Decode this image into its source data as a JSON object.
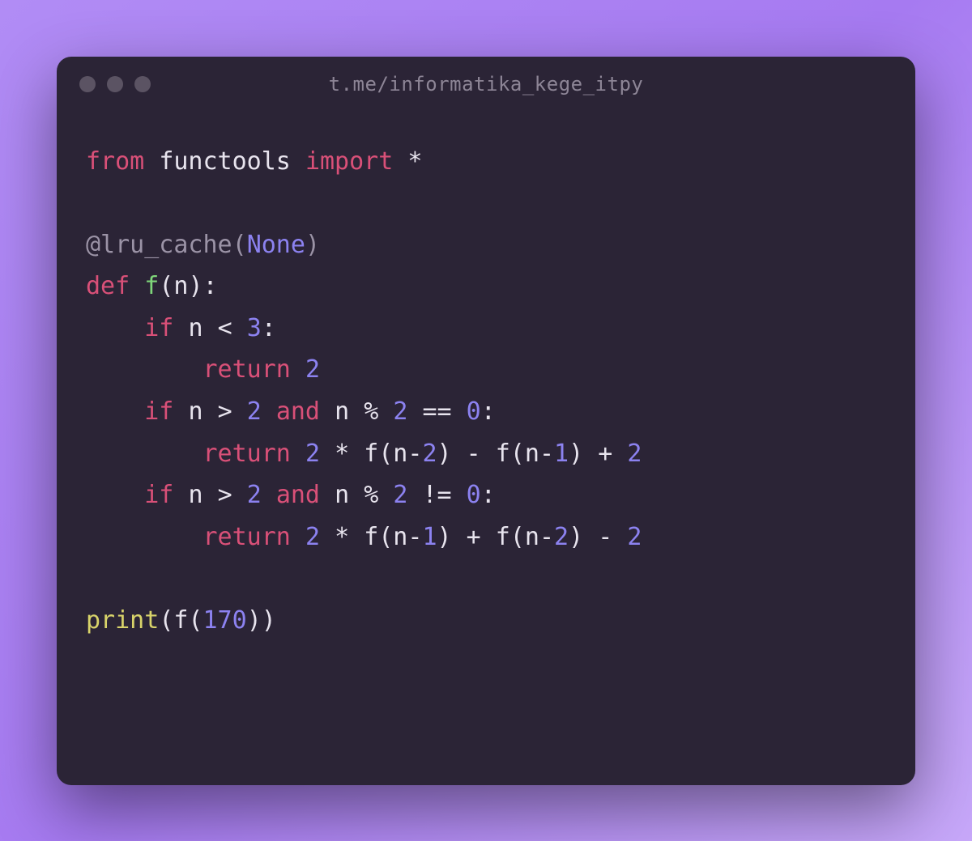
{
  "window": {
    "title": "t.me/informatika_kege_itpy"
  },
  "code": {
    "lines": [
      [
        {
          "text": "from",
          "cls": "kw"
        },
        {
          "text": " ",
          "cls": ""
        },
        {
          "text": "functools",
          "cls": "mod"
        },
        {
          "text": " ",
          "cls": ""
        },
        {
          "text": "import",
          "cls": "kw"
        },
        {
          "text": " ",
          "cls": ""
        },
        {
          "text": "*",
          "cls": "star"
        }
      ],
      [],
      [
        {
          "text": "@lru_cache",
          "cls": "dec"
        },
        {
          "text": "(",
          "cls": "dec"
        },
        {
          "text": "None",
          "cls": "none"
        },
        {
          "text": ")",
          "cls": "dec"
        }
      ],
      [
        {
          "text": "def",
          "cls": "kw"
        },
        {
          "text": " ",
          "cls": ""
        },
        {
          "text": "f",
          "cls": "fn"
        },
        {
          "text": "(",
          "cls": "punc"
        },
        {
          "text": "n",
          "cls": "var"
        },
        {
          "text": ")",
          "cls": "punc"
        },
        {
          "text": ":",
          "cls": "punc"
        }
      ],
      [
        {
          "text": "    ",
          "cls": ""
        },
        {
          "text": "if",
          "cls": "kw"
        },
        {
          "text": " ",
          "cls": ""
        },
        {
          "text": "n",
          "cls": "var"
        },
        {
          "text": " ",
          "cls": ""
        },
        {
          "text": "<",
          "cls": "op"
        },
        {
          "text": " ",
          "cls": ""
        },
        {
          "text": "3",
          "cls": "num"
        },
        {
          "text": ":",
          "cls": "punc"
        }
      ],
      [
        {
          "text": "        ",
          "cls": ""
        },
        {
          "text": "return",
          "cls": "kw"
        },
        {
          "text": " ",
          "cls": ""
        },
        {
          "text": "2",
          "cls": "num"
        }
      ],
      [
        {
          "text": "    ",
          "cls": ""
        },
        {
          "text": "if",
          "cls": "kw"
        },
        {
          "text": " ",
          "cls": ""
        },
        {
          "text": "n",
          "cls": "var"
        },
        {
          "text": " ",
          "cls": ""
        },
        {
          "text": ">",
          "cls": "op"
        },
        {
          "text": " ",
          "cls": ""
        },
        {
          "text": "2",
          "cls": "num"
        },
        {
          "text": " ",
          "cls": ""
        },
        {
          "text": "and",
          "cls": "kw"
        },
        {
          "text": " ",
          "cls": ""
        },
        {
          "text": "n",
          "cls": "var"
        },
        {
          "text": " ",
          "cls": ""
        },
        {
          "text": "%",
          "cls": "op"
        },
        {
          "text": " ",
          "cls": ""
        },
        {
          "text": "2",
          "cls": "num"
        },
        {
          "text": " ",
          "cls": ""
        },
        {
          "text": "==",
          "cls": "op"
        },
        {
          "text": " ",
          "cls": ""
        },
        {
          "text": "0",
          "cls": "num"
        },
        {
          "text": ":",
          "cls": "punc"
        }
      ],
      [
        {
          "text": "        ",
          "cls": ""
        },
        {
          "text": "return",
          "cls": "kw"
        },
        {
          "text": " ",
          "cls": ""
        },
        {
          "text": "2",
          "cls": "num"
        },
        {
          "text": " ",
          "cls": ""
        },
        {
          "text": "*",
          "cls": "op"
        },
        {
          "text": " ",
          "cls": ""
        },
        {
          "text": "f(n",
          "cls": "var"
        },
        {
          "text": "-",
          "cls": "op"
        },
        {
          "text": "2",
          "cls": "num"
        },
        {
          "text": ")",
          "cls": "punc"
        },
        {
          "text": " ",
          "cls": ""
        },
        {
          "text": "-",
          "cls": "op"
        },
        {
          "text": " ",
          "cls": ""
        },
        {
          "text": "f(n",
          "cls": "var"
        },
        {
          "text": "-",
          "cls": "op"
        },
        {
          "text": "1",
          "cls": "num"
        },
        {
          "text": ")",
          "cls": "punc"
        },
        {
          "text": " ",
          "cls": ""
        },
        {
          "text": "+",
          "cls": "op"
        },
        {
          "text": " ",
          "cls": ""
        },
        {
          "text": "2",
          "cls": "num"
        }
      ],
      [
        {
          "text": "    ",
          "cls": ""
        },
        {
          "text": "if",
          "cls": "kw"
        },
        {
          "text": " ",
          "cls": ""
        },
        {
          "text": "n",
          "cls": "var"
        },
        {
          "text": " ",
          "cls": ""
        },
        {
          "text": ">",
          "cls": "op"
        },
        {
          "text": " ",
          "cls": ""
        },
        {
          "text": "2",
          "cls": "num"
        },
        {
          "text": " ",
          "cls": ""
        },
        {
          "text": "and",
          "cls": "kw"
        },
        {
          "text": " ",
          "cls": ""
        },
        {
          "text": "n",
          "cls": "var"
        },
        {
          "text": " ",
          "cls": ""
        },
        {
          "text": "%",
          "cls": "op"
        },
        {
          "text": " ",
          "cls": ""
        },
        {
          "text": "2",
          "cls": "num"
        },
        {
          "text": " ",
          "cls": ""
        },
        {
          "text": "!=",
          "cls": "op"
        },
        {
          "text": " ",
          "cls": ""
        },
        {
          "text": "0",
          "cls": "num"
        },
        {
          "text": ":",
          "cls": "punc"
        }
      ],
      [
        {
          "text": "        ",
          "cls": ""
        },
        {
          "text": "return",
          "cls": "kw"
        },
        {
          "text": " ",
          "cls": ""
        },
        {
          "text": "2",
          "cls": "num"
        },
        {
          "text": " ",
          "cls": ""
        },
        {
          "text": "*",
          "cls": "op"
        },
        {
          "text": " ",
          "cls": ""
        },
        {
          "text": "f(n",
          "cls": "var"
        },
        {
          "text": "-",
          "cls": "op"
        },
        {
          "text": "1",
          "cls": "num"
        },
        {
          "text": ")",
          "cls": "punc"
        },
        {
          "text": " ",
          "cls": ""
        },
        {
          "text": "+",
          "cls": "op"
        },
        {
          "text": " ",
          "cls": ""
        },
        {
          "text": "f(n",
          "cls": "var"
        },
        {
          "text": "-",
          "cls": "op"
        },
        {
          "text": "2",
          "cls": "num"
        },
        {
          "text": ")",
          "cls": "punc"
        },
        {
          "text": " ",
          "cls": ""
        },
        {
          "text": "-",
          "cls": "op"
        },
        {
          "text": " ",
          "cls": ""
        },
        {
          "text": "2",
          "cls": "num"
        }
      ],
      [],
      [
        {
          "text": "print",
          "cls": "call"
        },
        {
          "text": "(",
          "cls": "punc"
        },
        {
          "text": "f(",
          "cls": "var"
        },
        {
          "text": "170",
          "cls": "num"
        },
        {
          "text": "))",
          "cls": "punc"
        }
      ]
    ]
  }
}
